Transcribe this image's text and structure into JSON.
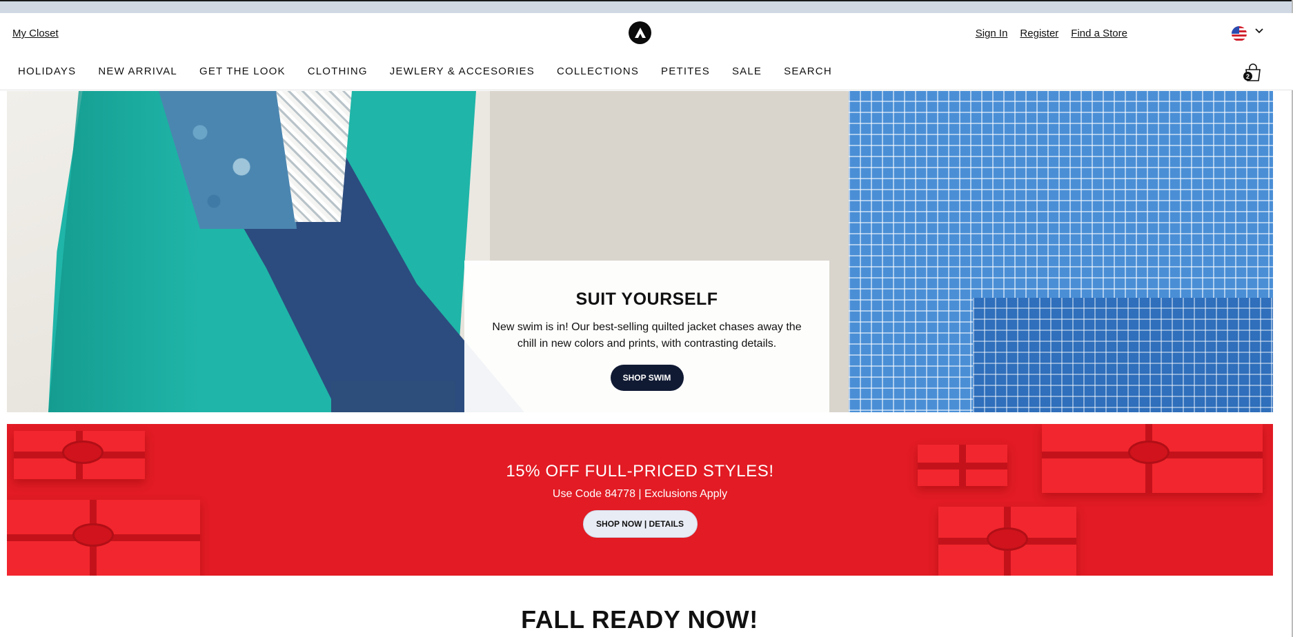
{
  "header": {
    "my_closet": "My Closet",
    "sign_in": "Sign In",
    "register": "Register",
    "find_store": "Find a Store",
    "cart_count": "2"
  },
  "nav": {
    "items": [
      "HOLIDAYS",
      "NEW ARRIVAL",
      "GET THE LOOK",
      "CLOTHING",
      "JEWLERY & ACCESORIES",
      "COLLECTIONS",
      "PETITES",
      "SALE",
      "SEARCH"
    ]
  },
  "hero": {
    "title": "SUIT YOURSELF",
    "body": "New swim is in! Our best-selling quilted jacket chases away the chill in new colors and prints, with contrasting details.",
    "button": "SHOP SWIM"
  },
  "promo": {
    "title": "15% OFF FULL-PRICED STYLES!",
    "subtitle": "Use Code 84778 | Exclusions Apply",
    "button": "SHOP NOW | DETAILS"
  },
  "section": {
    "title": "FALL READY NOW!"
  },
  "colors": {
    "promo_red": "#e21b24",
    "dark_button": "#101a33",
    "light_button": "#e8ecf5"
  }
}
